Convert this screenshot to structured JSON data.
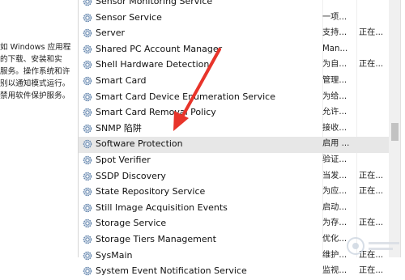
{
  "description_panel": {
    "lines": [
      "如 Windows 应用程",
      "的下载、安装和实",
      "服务。操作系统和许",
      "别以通知模式运行。",
      "禁用软件保护服务。"
    ]
  },
  "services": [
    {
      "name": "Sensor Monitoring Service",
      "description": "",
      "status": ""
    },
    {
      "name": "Sensor Service",
      "description": "一项...",
      "status": ""
    },
    {
      "name": "Server",
      "description": "支持...",
      "status": "正在..."
    },
    {
      "name": "Shared PC Account Manager",
      "description": "Man...",
      "status": ""
    },
    {
      "name": "Shell Hardware Detection",
      "description": "为自...",
      "status": "正在..."
    },
    {
      "name": "Smart Card",
      "description": "管理...",
      "status": ""
    },
    {
      "name": "Smart Card Device Enumeration Service",
      "description": "为给...",
      "status": ""
    },
    {
      "name": "Smart Card Removal Policy",
      "description": "允许...",
      "status": ""
    },
    {
      "name": "SNMP 陷阱",
      "description": "接收...",
      "status": ""
    },
    {
      "name": "Software Protection",
      "description": "启用 ...",
      "status": ""
    },
    {
      "name": "Spot Verifier",
      "description": "验证...",
      "status": ""
    },
    {
      "name": "SSDP Discovery",
      "description": "当发...",
      "status": "正在..."
    },
    {
      "name": "State Repository Service",
      "description": "为应...",
      "status": "正在..."
    },
    {
      "name": "Still Image Acquisition Events",
      "description": "启动...",
      "status": ""
    },
    {
      "name": "Storage Service",
      "description": "为存...",
      "status": "正在..."
    },
    {
      "name": "Storage Tiers Management",
      "description": "优化...",
      "status": ""
    },
    {
      "name": "SysMain",
      "description": "维护...",
      "status": "正在..."
    },
    {
      "name": "System Event Notification Service",
      "description": "监视...",
      "status": "正在..."
    }
  ],
  "selected_service": "Software Protection",
  "colors": {
    "arrow": "#e8342a",
    "selection": "#e7e7e7",
    "gear": "#5b7fa8"
  },
  "icons": {
    "service": "gear-icon",
    "annotation": "red-arrow",
    "watermark": "baidu-jingyan-logo"
  }
}
